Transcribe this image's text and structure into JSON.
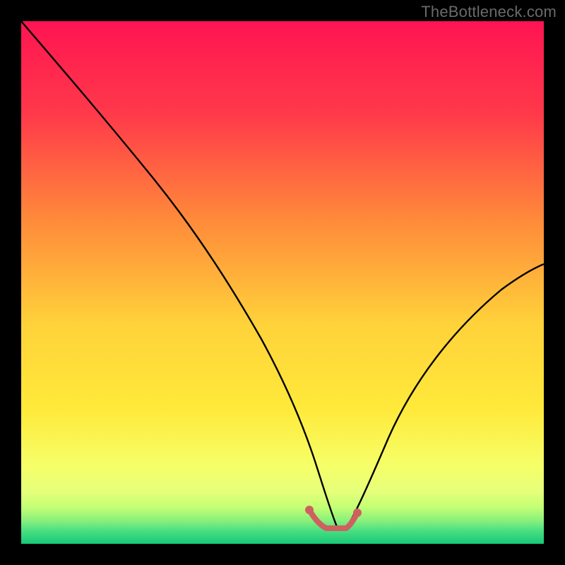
{
  "watermark": "TheBottleneck.com",
  "colors": {
    "frame": "#000000",
    "curve": "#000000",
    "marker": "#cf6060",
    "gradient_top": "#ff1452",
    "gradient_mid1": "#ff7a3c",
    "gradient_mid2": "#ffd93a",
    "gradient_mid3": "#f8ff62",
    "gradient_green1": "#b9ff6d",
    "gradient_green2": "#46e084",
    "gradient_green3": "#17c877"
  },
  "chart_data": {
    "type": "line",
    "title": "",
    "xlabel": "",
    "ylabel": "",
    "xlim": [
      0,
      100
    ],
    "ylim": [
      0,
      100
    ],
    "x": [
      0,
      5,
      10,
      15,
      20,
      25,
      30,
      35,
      40,
      45,
      50,
      53,
      55,
      57,
      60,
      62,
      65,
      70,
      75,
      80,
      85,
      90,
      95,
      100
    ],
    "values": [
      100,
      91,
      82,
      73,
      64,
      55,
      46,
      38,
      30,
      22,
      14,
      7,
      3,
      1,
      0,
      0,
      1,
      5,
      13,
      22,
      32,
      41,
      48,
      53
    ],
    "series": [
      {
        "name": "bottleneck-curve",
        "x": [
          0,
          5,
          10,
          15,
          20,
          25,
          30,
          35,
          40,
          45,
          50,
          53,
          55,
          57,
          60,
          62,
          65,
          70,
          75,
          80,
          85,
          90,
          95,
          100
        ],
        "values": [
          100,
          91,
          82,
          73,
          64,
          55,
          46,
          38,
          30,
          22,
          14,
          7,
          3,
          1,
          0,
          0,
          1,
          5,
          13,
          22,
          32,
          41,
          48,
          53
        ]
      }
    ],
    "highlight": {
      "x_range": [
        55,
        63
      ],
      "y": 3,
      "color": "#cf6060"
    }
  }
}
